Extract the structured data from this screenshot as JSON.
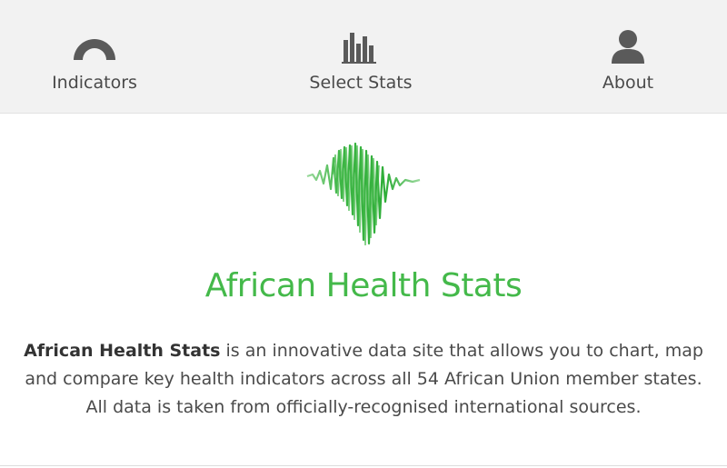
{
  "nav": {
    "items": [
      {
        "label": "Indicators",
        "icon": "dashboard-gauge-icon"
      },
      {
        "label": "Select Stats",
        "icon": "bar-chart-icon"
      },
      {
        "label": "About",
        "icon": "person-icon"
      }
    ],
    "icon_color": "#5a5a5a",
    "background": "#f2f2f2"
  },
  "brand": {
    "name": "African Health Stats",
    "logo_icon": "soundwave-africa-logo-icon",
    "color": "#44b94a"
  },
  "intro": {
    "brand_bold": "African Health Stats",
    "line1_rest": " is an innovative data site that allows you to chart, map",
    "line2": "and compare key health indicators across all 54 African Union member states.",
    "line3": "All data is taken from officially-recognised international sources."
  }
}
